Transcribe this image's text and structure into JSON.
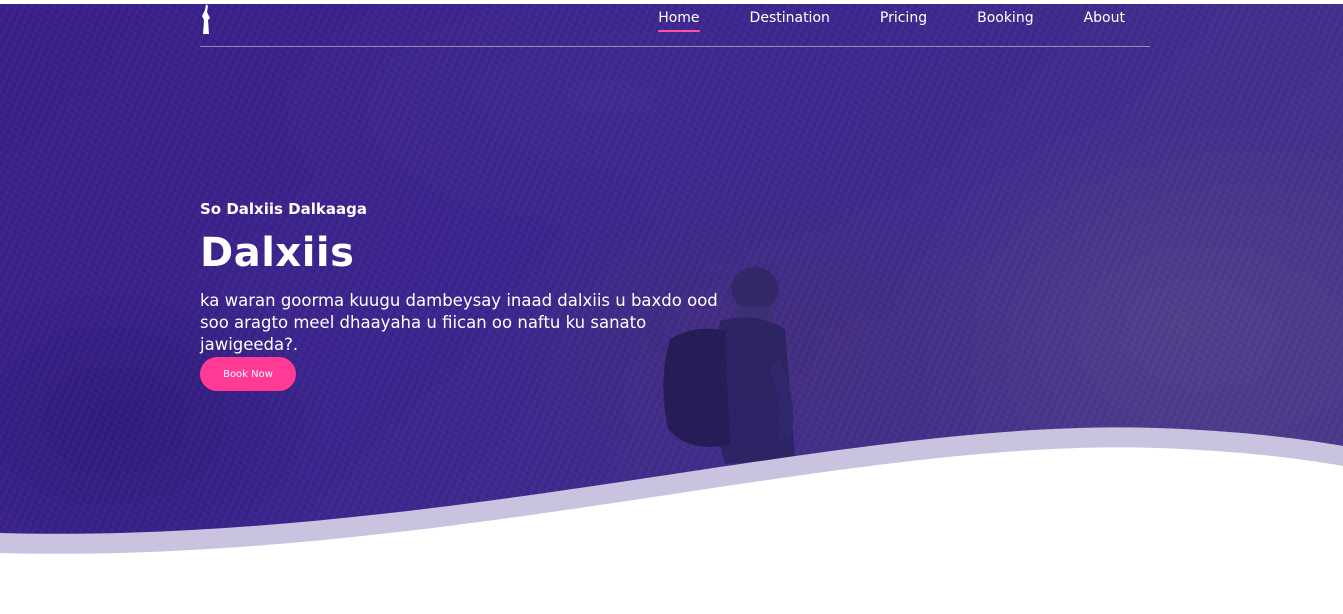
{
  "nav": {
    "items": [
      {
        "label": "Home",
        "active": true
      },
      {
        "label": "Destination",
        "active": false
      },
      {
        "label": "Pricing",
        "active": false
      },
      {
        "label": "Booking",
        "active": false
      },
      {
        "label": "About",
        "active": false
      }
    ],
    "active_indicator_color": "#ff4fa3"
  },
  "hero": {
    "eyebrow": "So Dalxiis Dalkaaga",
    "title": "Dalxiis",
    "description_line1": "ka waran goorma kuugu dambeysay inaad dalxiis u baxdo ood",
    "description_line2": "soo aragto meel dhaayaha u fiican oo naftu ku sanato jawigeeda?.",
    "cta_label": "Book Now",
    "overlay_color": "#3a1f8a",
    "cta_color": "#ff3b95",
    "logo_icon": "hiker-silhouette-icon",
    "background_icon": "hiker-photo"
  }
}
